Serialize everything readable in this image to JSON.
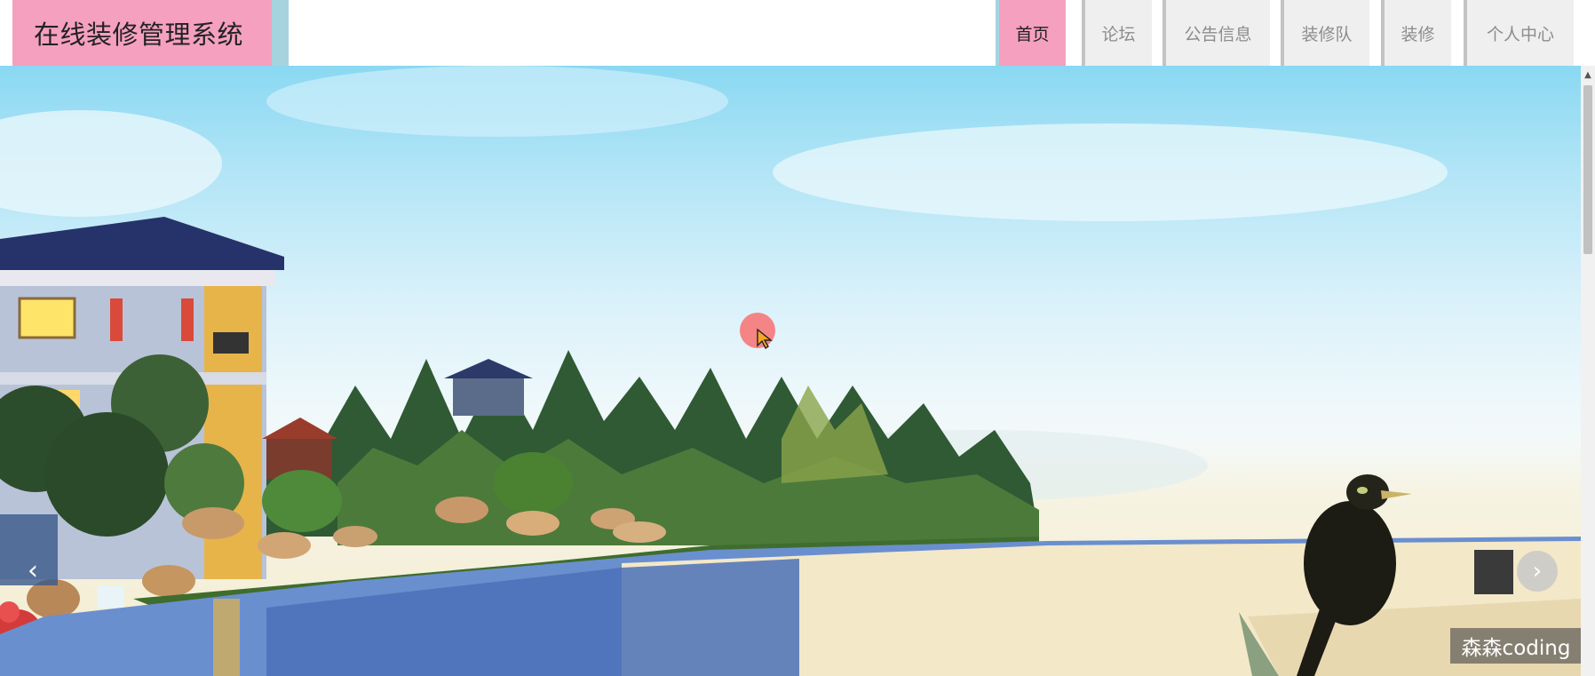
{
  "header": {
    "site_title": "在线装修管理系统"
  },
  "nav": {
    "items": [
      {
        "label": "首页",
        "active": true
      },
      {
        "label": "论坛",
        "active": false
      },
      {
        "label": "公告信息",
        "active": false
      },
      {
        "label": "装修队",
        "active": false
      },
      {
        "label": "装修",
        "active": false
      },
      {
        "label": "个人中心",
        "active": false
      }
    ]
  },
  "carousel": {
    "prev_icon": "chevron-left-icon",
    "next_icon": "chevron-right-icon"
  },
  "watermark": "森森coding",
  "colors": {
    "brand_bg": "#f5a0bf",
    "brand_edge": "#a7d3df",
    "nav_bg": "#efefef",
    "nav_text": "#8c8c8c"
  }
}
